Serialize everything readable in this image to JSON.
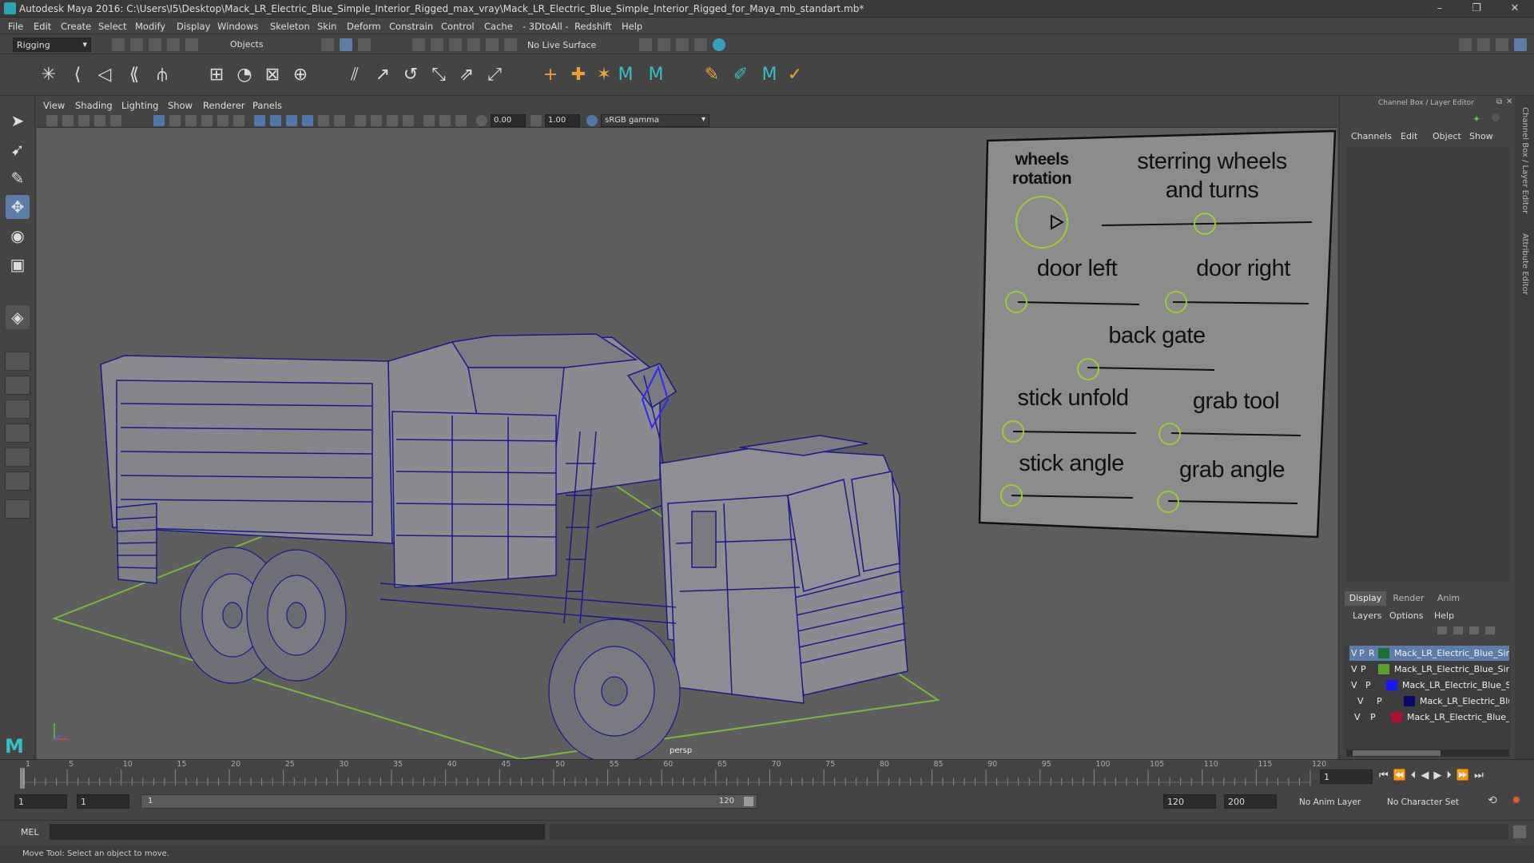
{
  "window": {
    "title": "Autodesk Maya 2016: C:\\Users\\I5\\Desktop\\Mack_LR_Electric_Blue_Simple_Interior_Rigged_max_vray\\Mack_LR_Electric_Blue_Simple_Interior_Rigged_for_Maya_mb_standart.mb*",
    "minimize": "–",
    "restore": "❐",
    "close": "✕"
  },
  "menubar": [
    "File",
    "Edit",
    "Create",
    "Select",
    "Modify",
    "Display",
    "Windows",
    "Skeleton",
    "Skin",
    "Deform",
    "Constrain",
    "Control",
    "Cache",
    "- 3DtoAll -",
    "Redshift",
    "Help"
  ],
  "statusline": {
    "menuset": "Rigging",
    "selection_mode": "Objects",
    "live_surface": "No Live Surface"
  },
  "viewport": {
    "menus": [
      "View",
      "Shading",
      "Lighting",
      "Show",
      "Renderer",
      "Panels"
    ],
    "exposure": "0.00",
    "gamma": "1.00",
    "color_space": "sRGB gamma",
    "camera_label": "persp"
  },
  "controls_board": {
    "labels": {
      "wheels_rotation": "wheels rotation",
      "steering": "sterring wheels and turns",
      "door_left": "door left",
      "door_right": "door right",
      "back_gate": "back gate",
      "stick_unfold": "stick unfold",
      "grab_tool": "grab tool",
      "stick_angle": "stick angle",
      "grab_angle": "grab angle"
    },
    "control_color": "#9acd32"
  },
  "channel_box": {
    "title": "Channel Box / Layer Editor",
    "menus": [
      "Channels",
      "Edit",
      "Object",
      "Show"
    ]
  },
  "layer_editor": {
    "tabs": [
      "Display",
      "Render",
      "Anim"
    ],
    "active_tab": "Display",
    "menus": [
      "Layers",
      "Options",
      "Help"
    ],
    "layers": [
      {
        "v": "V",
        "p": "P",
        "r": "R",
        "name": "Mack_LR_Electric_Blue_Simple",
        "color": "#1e6e3a",
        "selected": true
      },
      {
        "v": "V",
        "p": "P",
        "r": "",
        "name": "Mack_LR_Electric_Blue_Simple",
        "color": "#5aa02c",
        "selected": false
      },
      {
        "v": "V",
        "p": "P",
        "r": "",
        "name": "Mack_LR_Electric_Blue_Simp",
        "color": "#1515ff",
        "selected": false
      },
      {
        "v": "V",
        "p": "P",
        "r": "",
        "name": "Mack_LR_Electric_Blue_",
        "color": "#0a0a6e",
        "selected": false
      },
      {
        "v": "V",
        "p": "P",
        "r": "",
        "name": "Mack_LR_Electric_Blue_Sim",
        "color": "#b01030",
        "selected": false
      }
    ]
  },
  "side_tabs": [
    "Channel Box / Layer Editor",
    "Attribute Editor"
  ],
  "timeline": {
    "ticks": [
      "1",
      "5",
      "10",
      "15",
      "20",
      "25",
      "30",
      "35",
      "40",
      "45",
      "50",
      "55",
      "60",
      "65",
      "70",
      "75",
      "80",
      "85",
      "90",
      "95",
      "100",
      "105",
      "110",
      "115",
      "120"
    ],
    "current_frame": "1"
  },
  "range": {
    "start": "1",
    "playback_start": "1",
    "slider_start": "1",
    "slider_end": "120",
    "playback_end": "120",
    "end": "200",
    "anim_layer": "No Anim Layer",
    "character_set": "No Character Set"
  },
  "command": {
    "language": "MEL"
  },
  "help": {
    "text": "Move Tool: Select an object to move."
  },
  "colors": {
    "wire": "#1a1a8c",
    "grid": "#7ab83c",
    "active_tool": "#5b7da8"
  }
}
